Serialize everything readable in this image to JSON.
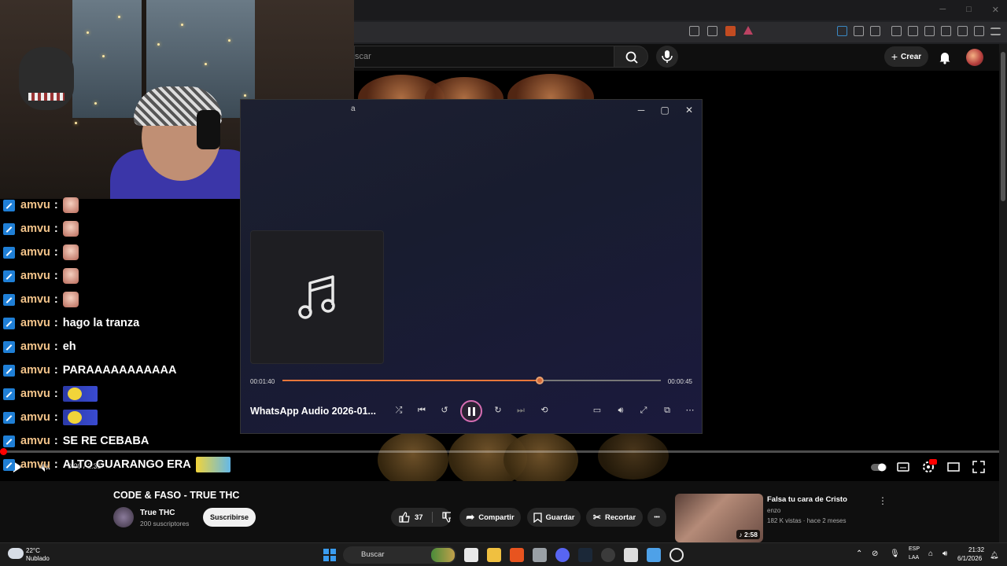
{
  "youtube": {
    "search_placeholder": "scar",
    "create_label": "Crear",
    "video_time": "0:00 / 2:31",
    "video_title": "CODE & FASO - TRUE THC",
    "channel_name": "True THC",
    "channel_subs": "200 suscriptores",
    "subscribe_label": "Suscribirse",
    "like_count": "37",
    "share_label": "Compartir",
    "save_label": "Guardar",
    "clip_label": "Recortar",
    "more_label": "•••",
    "recommended": {
      "title": "Falsa tu cara de Cristo",
      "channel": "enzo",
      "meta": "182 K vistas · hace 2 meses",
      "duration": "2:58"
    }
  },
  "chat": {
    "messages": [
      {
        "user": "amvu",
        "sep": ":",
        "text": "",
        "emote": "emote"
      },
      {
        "user": "amvu",
        "sep": ":",
        "text": "",
        "emote": "emote"
      },
      {
        "user": "amvu",
        "sep": ":",
        "text": "",
        "emote": "emote"
      },
      {
        "user": "amvu",
        "sep": ":",
        "text": "",
        "emote": "emote"
      },
      {
        "user": "amvu",
        "sep": ":",
        "text": "",
        "emote": "emote"
      },
      {
        "user": "amvu",
        "sep": ":",
        "text": "hago la tranza",
        "emote": ""
      },
      {
        "user": "amvu",
        "sep": ":",
        "text": "eh",
        "emote": ""
      },
      {
        "user": "amvu",
        "sep": ":",
        "text": "PARAAAAAAAAAAA",
        "emote": ""
      },
      {
        "user": "amvu",
        "sep": ":",
        "text": "",
        "emote": "wide"
      },
      {
        "user": "amvu",
        "sep": ":",
        "text": "",
        "emote": "wide"
      },
      {
        "user": "amvu",
        "sep": ":",
        "text": "SE RE CEBABA",
        "emote": ""
      },
      {
        "user": "amvu",
        "sep": ":",
        "text": "ALTO GUARANGO ERA",
        "emote": "wide2"
      }
    ]
  },
  "player": {
    "window_title": "a",
    "time_elapsed": "00:01:40",
    "time_remaining": "00:00:45",
    "progress": 0.68,
    "track_name": "WhatsApp Audio 2026-01...",
    "minimize_glyph": "─",
    "maximize_glyph": "▢",
    "close_glyph": "✕"
  },
  "taskbar": {
    "weather_temp": "22°C",
    "weather_desc": "Nublado",
    "search_label": "Buscar",
    "lang_line1": "ESP",
    "lang_line2": "LAA",
    "time": "21:32",
    "date": "6/1/2026"
  },
  "colors": {
    "accent_orange": "#e8763a",
    "youtube_red": "#ff0000",
    "chat_badge": "#1f7fd6"
  }
}
